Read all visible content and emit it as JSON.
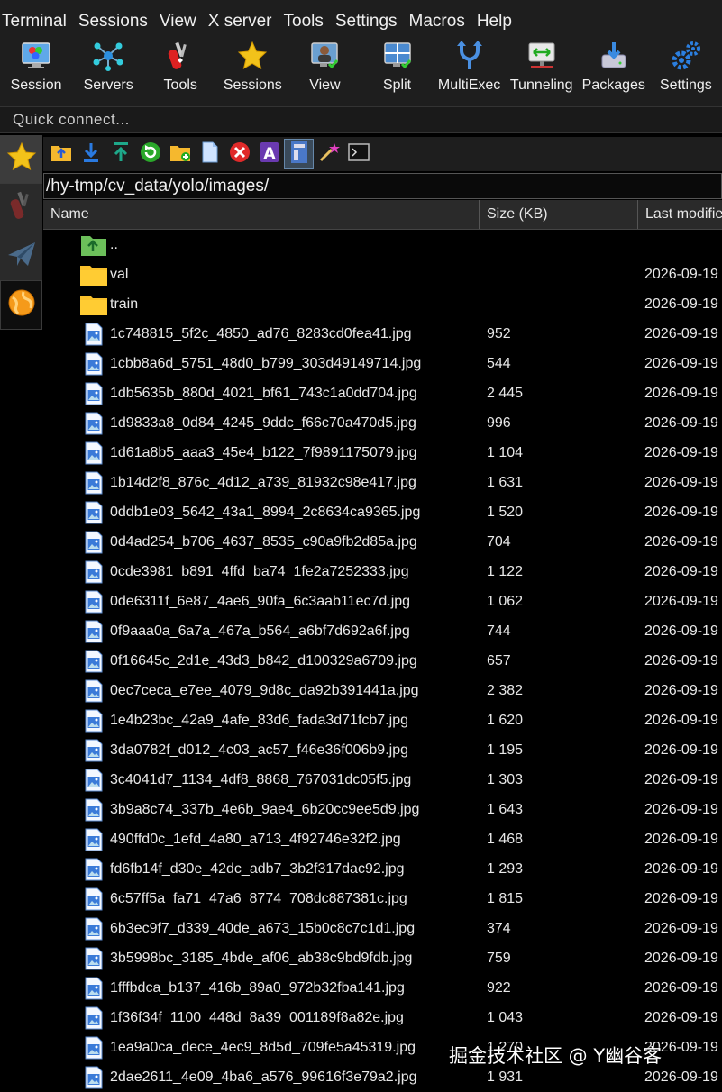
{
  "menu": [
    "Terminal",
    "Sessions",
    "View",
    "X server",
    "Tools",
    "Settings",
    "Macros",
    "Help"
  ],
  "toolbar": [
    {
      "label": "Session",
      "icon": "session-monitor-icon"
    },
    {
      "label": "Servers",
      "icon": "servers-network-icon"
    },
    {
      "label": "Tools",
      "icon": "tools-knife-icon"
    },
    {
      "label": "Sessions",
      "icon": "star-icon"
    },
    {
      "label": "View",
      "icon": "view-user-monitor-icon"
    },
    {
      "label": "Split",
      "icon": "split-window-icon"
    },
    {
      "label": "MultiExec",
      "icon": "multiexec-fork-icon"
    },
    {
      "label": "Tunneling",
      "icon": "tunneling-arrows-icon"
    },
    {
      "label": "Packages",
      "icon": "packages-download-icon"
    },
    {
      "label": "Settings",
      "icon": "settings-gears-icon"
    }
  ],
  "quick_connect": {
    "placeholder": "Quick connect..."
  },
  "side_tabs": [
    "favorites-star-icon",
    "tools-knife-icon",
    "send-plane-icon",
    "sftp-globe-icon"
  ],
  "path": "/hy-tmp/cv_data/yolo/images/",
  "columns": {
    "name": "Name",
    "size": "Size (KB)",
    "date": "Last modified"
  },
  "rows": [
    {
      "name": "..",
      "size": "",
      "date": "",
      "type": "parent"
    },
    {
      "name": "val",
      "size": "",
      "date": "2026-09-19",
      "type": "folder"
    },
    {
      "name": "train",
      "size": "",
      "date": "2026-09-19",
      "type": "folder"
    },
    {
      "name": "1c748815_5f2c_4850_ad76_8283cd0fea41.jpg",
      "size": "952",
      "date": "2026-09-19",
      "type": "file"
    },
    {
      "name": "1cbb8a6d_5751_48d0_b799_303d49149714.jpg",
      "size": "544",
      "date": "2026-09-19",
      "type": "file"
    },
    {
      "name": "1db5635b_880d_4021_bf61_743c1a0dd704.jpg",
      "size": "2 445",
      "date": "2026-09-19",
      "type": "file"
    },
    {
      "name": "1d9833a8_0d84_4245_9ddc_f66c70a470d5.jpg",
      "size": "996",
      "date": "2026-09-19",
      "type": "file"
    },
    {
      "name": "1d61a8b5_aaa3_45e4_b122_7f9891175079.jpg",
      "size": "1 104",
      "date": "2026-09-19",
      "type": "file"
    },
    {
      "name": "1b14d2f8_876c_4d12_a739_81932c98e417.jpg",
      "size": "1 631",
      "date": "2026-09-19",
      "type": "file"
    },
    {
      "name": "0ddb1e03_5642_43a1_8994_2c8634ca9365.jpg",
      "size": "1 520",
      "date": "2026-09-19",
      "type": "file"
    },
    {
      "name": "0d4ad254_b706_4637_8535_c90a9fb2d85a.jpg",
      "size": "704",
      "date": "2026-09-19",
      "type": "file"
    },
    {
      "name": "0cde3981_b891_4ffd_ba74_1fe2a7252333.jpg",
      "size": "1 122",
      "date": "2026-09-19",
      "type": "file"
    },
    {
      "name": "0de6311f_6e87_4ae6_90fa_6c3aab11ec7d.jpg",
      "size": "1 062",
      "date": "2026-09-19",
      "type": "file"
    },
    {
      "name": "0f9aaa0a_6a7a_467a_b564_a6bf7d692a6f.jpg",
      "size": "744",
      "date": "2026-09-19",
      "type": "file"
    },
    {
      "name": "0f16645c_2d1e_43d3_b842_d100329a6709.jpg",
      "size": "657",
      "date": "2026-09-19",
      "type": "file"
    },
    {
      "name": "0ec7ceca_e7ee_4079_9d8c_da92b391441a.jpg",
      "size": "2 382",
      "date": "2026-09-19",
      "type": "file"
    },
    {
      "name": "1e4b23bc_42a9_4afe_83d6_fada3d71fcb7.jpg",
      "size": "1 620",
      "date": "2026-09-19",
      "type": "file"
    },
    {
      "name": "3da0782f_d012_4c03_ac57_f46e36f006b9.jpg",
      "size": "1 195",
      "date": "2026-09-19",
      "type": "file"
    },
    {
      "name": "3c4041d7_1134_4df8_8868_767031dc05f5.jpg",
      "size": "1 303",
      "date": "2026-09-19",
      "type": "file"
    },
    {
      "name": "3b9a8c74_337b_4e6b_9ae4_6b20cc9ee5d9.jpg",
      "size": "1 643",
      "date": "2026-09-19",
      "type": "file"
    },
    {
      "name": "490ffd0c_1efd_4a80_a713_4f92746e32f2.jpg",
      "size": "1 468",
      "date": "2026-09-19",
      "type": "file"
    },
    {
      "name": "fd6fb14f_d30e_42dc_adb7_3b2f317dac92.jpg",
      "size": "1 293",
      "date": "2026-09-19",
      "type": "file"
    },
    {
      "name": "6c57ff5a_fa71_47a6_8774_708dc887381c.jpg",
      "size": "1 815",
      "date": "2026-09-19",
      "type": "file"
    },
    {
      "name": "6b3ec9f7_d339_40de_a673_15b0c8c7c1d1.jpg",
      "size": "374",
      "date": "2026-09-19",
      "type": "file"
    },
    {
      "name": "3b5998bc_3185_4bde_af06_ab38c9bd9fdb.jpg",
      "size": "759",
      "date": "2026-09-19",
      "type": "file"
    },
    {
      "name": "1fffbdca_b137_416b_89a0_972b32fba141.jpg",
      "size": "922",
      "date": "2026-09-19",
      "type": "file"
    },
    {
      "name": "1f36f34f_1100_448d_8a39_001189f8a82e.jpg",
      "size": "1 043",
      "date": "2026-09-19",
      "type": "file"
    },
    {
      "name": "1ea9a0ca_dece_4ec9_8d5d_709fe5a45319.jpg",
      "size": "1 270",
      "date": "2026-09-19",
      "type": "file"
    },
    {
      "name": "2dae2611_4e09_4ba6_a576_99616f3e79a2.jpg",
      "size": "1 931",
      "date": "2026-09-19",
      "type": "file"
    }
  ],
  "watermark": "掘金技术社区 @ Y幽谷客"
}
